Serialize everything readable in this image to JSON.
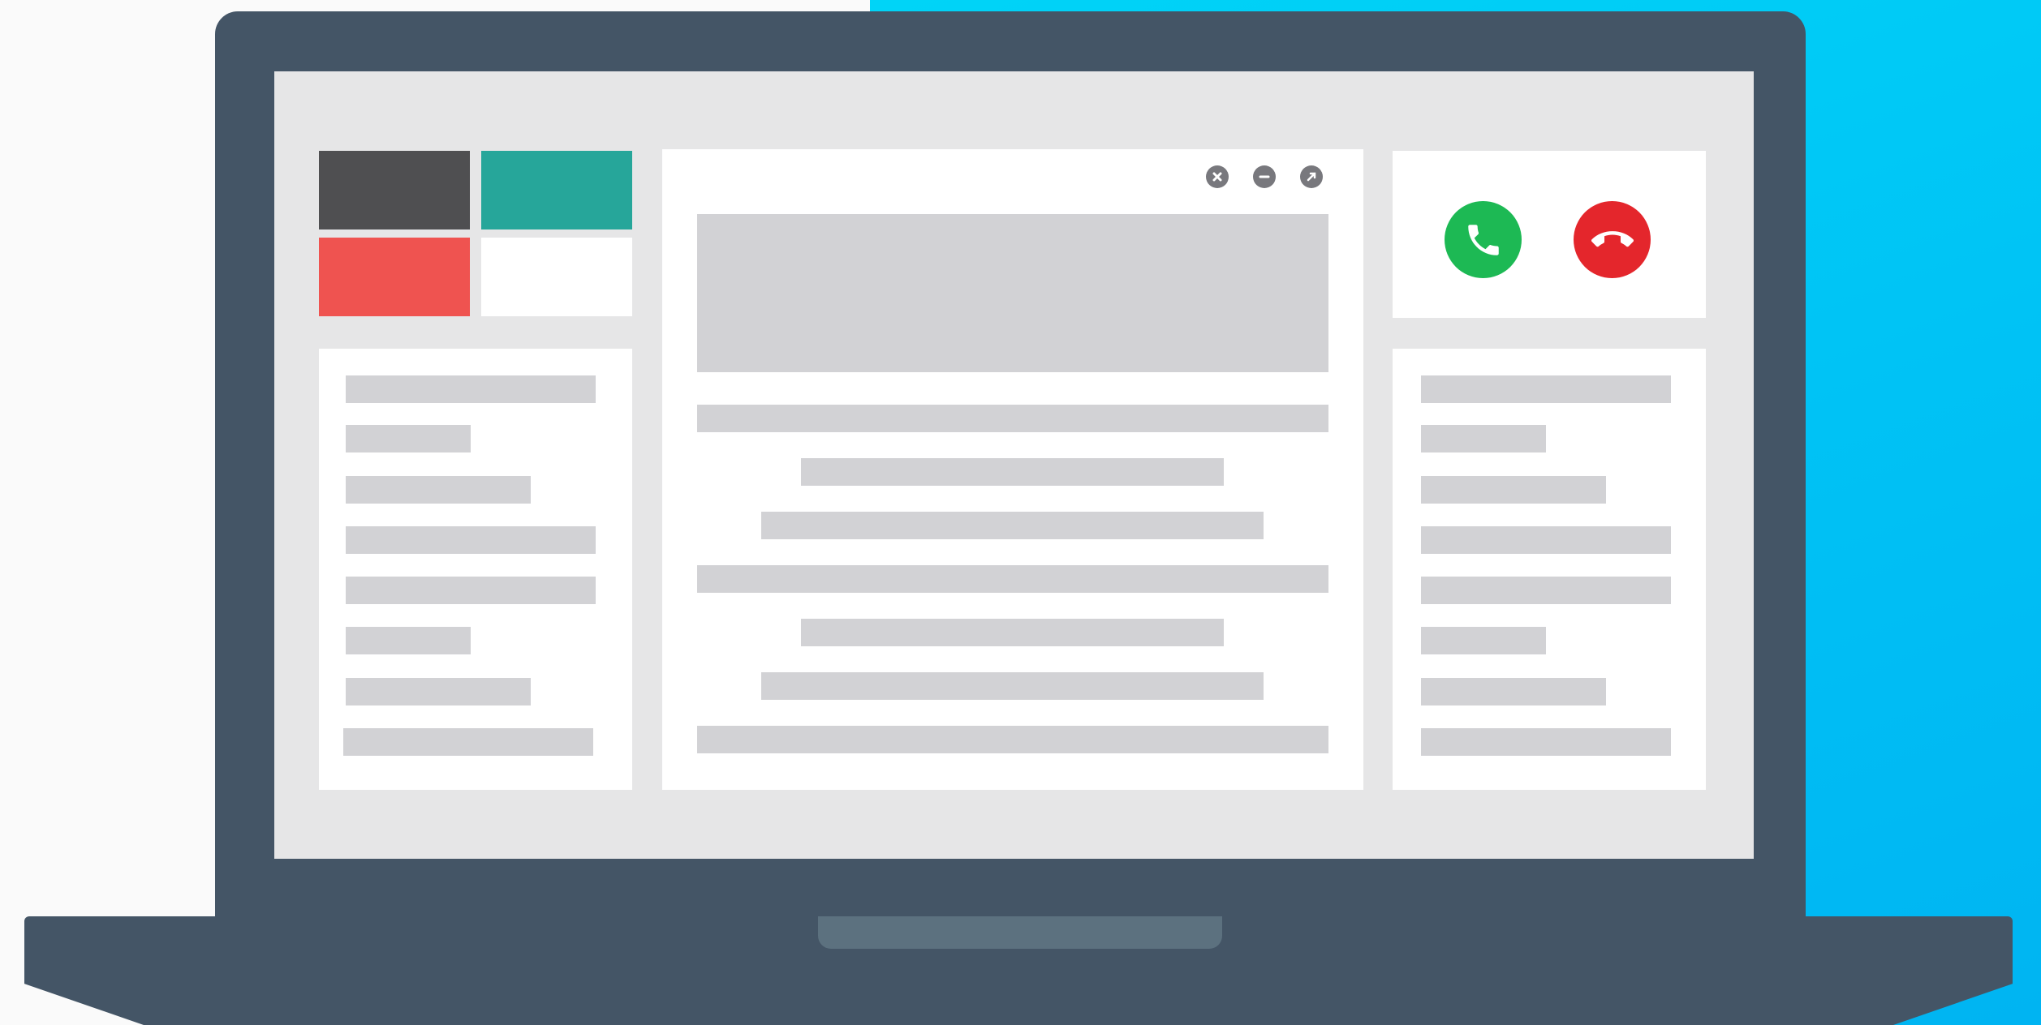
{
  "colors": {
    "background": "#fafafa",
    "accent_gradient": "#00c3f5",
    "laptop_body": "#445566",
    "screen": "#e6e6e7",
    "touchpad": "#5c717f",
    "placeholder_bar": "#d2d2d5",
    "answer_green": "#1db954",
    "decline_red": "#e4262c"
  },
  "tiles": [
    {
      "name": "dark-tile",
      "color": "#4f4f51"
    },
    {
      "name": "teal-tile",
      "color": "#26a69a"
    },
    {
      "name": "red-tile",
      "color": "#ef5350"
    },
    {
      "name": "white-tile",
      "color": "#ffffff"
    }
  ],
  "window_controls": [
    "close-icon",
    "minimize-icon",
    "maximize-icon"
  ],
  "call_buttons": {
    "answer_icon": "phone-answer-icon",
    "decline_icon": "phone-hangup-icon"
  }
}
